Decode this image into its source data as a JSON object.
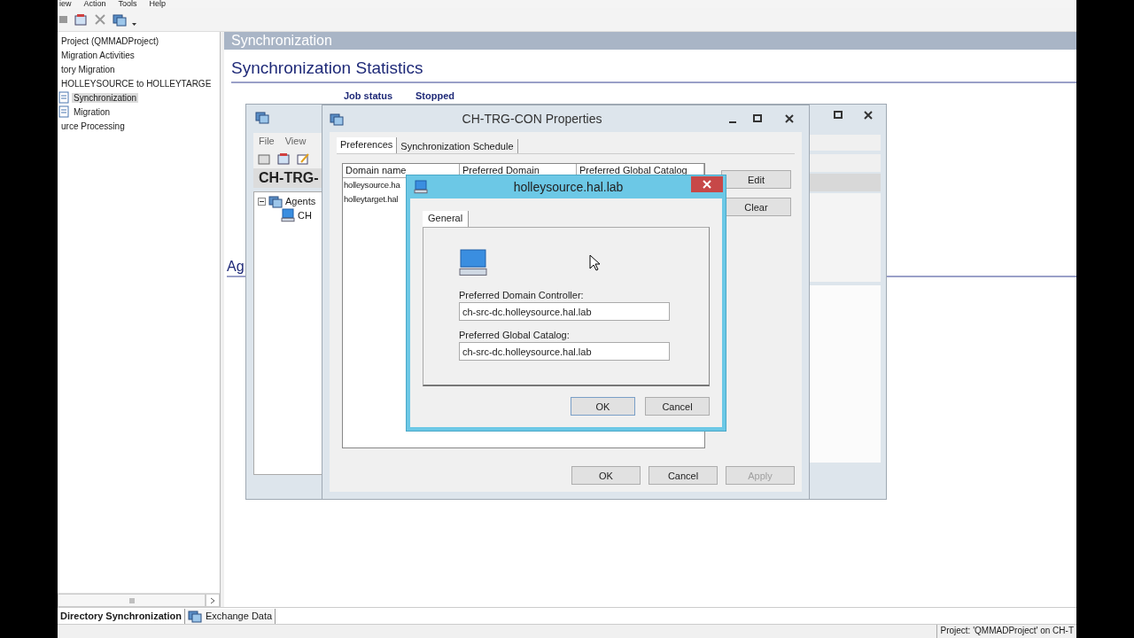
{
  "menu_bar": [
    "iew",
    "Action",
    "Tools",
    "Help"
  ],
  "tree": [
    {
      "label": "Project (QMMADProject)",
      "selected": false
    },
    {
      "label": "Migration Activities",
      "selected": false
    },
    {
      "label": "tory Migration",
      "selected": false
    },
    {
      "label": "HOLLEYSOURCE to HOLLEYTARGE",
      "selected": false,
      "children": [
        {
          "label": "Synchronization",
          "selected": true
        },
        {
          "label": "Migration",
          "selected": false
        }
      ]
    },
    {
      "label": "urce Processing",
      "selected": false
    }
  ],
  "pane": {
    "header": "Synchronization",
    "title": "Synchronization Statistics",
    "job_status_label": "Job status",
    "job_status": "Stopped",
    "section_heading": "Ag"
  },
  "bottom_tabs": [
    {
      "label": "Directory Synchronization",
      "selected": true
    },
    {
      "label": "Exchange Data",
      "selected": false
    }
  ],
  "status_bar": "Project: 'QMMADProject' on CH-T",
  "console_window": {
    "menu": [
      "File",
      "View"
    ],
    "heading": "CH-TRG-",
    "tree": [
      {
        "label": "Agents",
        "expanded": true,
        "children": [
          {
            "label": "CH"
          }
        ]
      }
    ]
  },
  "properties_window": {
    "title": "CH-TRG-CON Properties",
    "tabs": [
      {
        "label": "Preferences",
        "selected": true
      },
      {
        "label": "Synchronization Schedule",
        "selected": false
      }
    ],
    "columns": [
      "Domain name",
      "Preferred Domain",
      "Preferred Global Catalog"
    ],
    "rows": [
      [
        "holleysource.ha"
      ],
      [
        "holleytarget.hal"
      ]
    ],
    "side_buttons": [
      "Edit",
      "Clear"
    ],
    "buttons": [
      {
        "label": "OK",
        "disabled": false
      },
      {
        "label": "Cancel",
        "disabled": false
      },
      {
        "label": "Apply",
        "disabled": true
      }
    ]
  },
  "dialog": {
    "title": "holleysource.hal.lab",
    "tabs": [
      {
        "label": "General",
        "selected": true
      }
    ],
    "fields": [
      {
        "label": "Preferred Domain Controller:",
        "value": "ch-src-dc.holleysource.hal.lab"
      },
      {
        "label": "Preferred Global Catalog:",
        "value": "ch-src-dc.holleysource.hal.lab"
      }
    ],
    "buttons": [
      "OK",
      "Cancel"
    ]
  }
}
